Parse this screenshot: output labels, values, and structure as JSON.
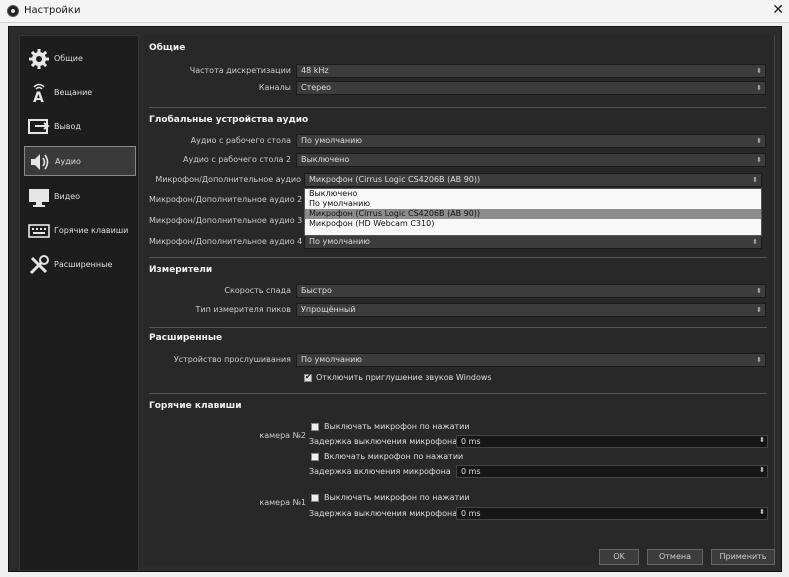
{
  "window": {
    "title": "Настройки",
    "close_glyph": "✕"
  },
  "sidebar": {
    "items": [
      {
        "label": "Общие",
        "icon": "gear-icon"
      },
      {
        "label": "Вещание",
        "icon": "broadcast-icon"
      },
      {
        "label": "Вывод",
        "icon": "output-icon"
      },
      {
        "label": "Аудио",
        "icon": "speaker-icon",
        "selected": true
      },
      {
        "label": "Видео",
        "icon": "monitor-icon"
      },
      {
        "label": "Горячие клавиши",
        "icon": "keyboard-icon"
      },
      {
        "label": "Расширенные",
        "icon": "tools-icon"
      }
    ]
  },
  "general": {
    "title": "Общие",
    "sample_rate_label": "Частота дискретизации",
    "sample_rate_value": "48 kHz",
    "channels_label": "Каналы",
    "channels_value": "Стерео"
  },
  "global_audio": {
    "title": "Глобальные устройства аудио",
    "desktop_label": "Аудио с рабочего стола",
    "desktop_value": "По умолчанию",
    "desktop2_label": "Аудио с рабочего стола 2",
    "desktop2_value": "Выключено",
    "mic_label": "Микрофон/Дополнительное аудио",
    "mic_value": "Микрофон (Cirrus Logic CS4206B (AB 90))",
    "mic2_label": "Микрофон/Дополнительное аудио 2",
    "mic3_label": "Микрофон/Дополнительное аудио 3",
    "mic4_label": "Микрофон/Дополнительное аудио 4",
    "mic4_value": "По умолчанию",
    "dropdown_options": [
      "Выключено",
      "По умолчанию",
      "Микрофон (Cirrus Logic CS4206B (AB 90))",
      "Микрофон (HD Webcam C310)"
    ]
  },
  "meters": {
    "title": "Измерители",
    "decay_label": "Скорость спада",
    "decay_value": "Быстро",
    "peak_label": "Тип измерителя пиков",
    "peak_value": "Упрощённый"
  },
  "advanced": {
    "title": "Расширенные",
    "monitor_label": "Устройство прослушивания",
    "monitor_value": "По умолчанию",
    "ducking_label": "Отключить приглушение звуков Windows",
    "ducking_checked": true
  },
  "hotkeys": {
    "title": "Горячие клавиши",
    "cam2_label": "камера №2",
    "cam1_label": "камера №1",
    "ptm_label": "Выключать микрофон по нажатии",
    "ptm_delay_label": "Задержка выключения микрофона",
    "ptt_label": "Включать микрофон по нажатии",
    "ptt_delay_label": "Задержка включения микрофона",
    "delay_value": "0 ms"
  },
  "buttons": {
    "ok": "OK",
    "cancel": "Отмена",
    "apply": "Применить"
  }
}
